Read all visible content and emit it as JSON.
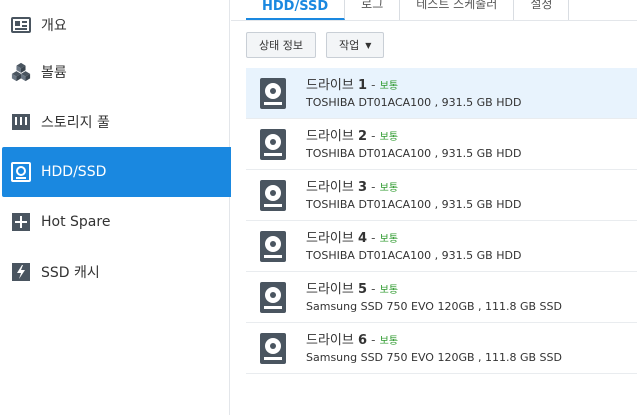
{
  "sidebar": {
    "items": [
      {
        "label": "개요",
        "icon": "overview-icon"
      },
      {
        "label": "볼륨",
        "icon": "volume-icon"
      },
      {
        "label": "스토리지 풀",
        "icon": "storage-pool-icon"
      },
      {
        "label": "HDD/SSD",
        "icon": "hdd-icon",
        "active": true
      },
      {
        "label": "Hot Spare",
        "icon": "hot-spare-icon"
      },
      {
        "label": "SSD 캐시",
        "icon": "ssd-cache-icon"
      }
    ]
  },
  "tabs": [
    {
      "label": "HDD/SSD",
      "active": true
    },
    {
      "label": "로그"
    },
    {
      "label": "테스트 스케줄러"
    },
    {
      "label": "설정"
    }
  ],
  "toolbar": {
    "status_info_label": "상태 정보",
    "action_label": "작업"
  },
  "drives": [
    {
      "name": "드라이브",
      "number": "1",
      "separator": "-",
      "status": "보통",
      "model": "TOSHIBA DT01ACA100 , 931.5 GB HDD",
      "selected": true
    },
    {
      "name": "드라이브",
      "number": "2",
      "separator": "-",
      "status": "보통",
      "model": "TOSHIBA DT01ACA100 , 931.5 GB HDD"
    },
    {
      "name": "드라이브",
      "number": "3",
      "separator": "-",
      "status": "보통",
      "model": "TOSHIBA DT01ACA100 , 931.5 GB HDD"
    },
    {
      "name": "드라이브",
      "number": "4",
      "separator": "-",
      "status": "보통",
      "model": "TOSHIBA DT01ACA100 , 931.5 GB HDD"
    },
    {
      "name": "드라이브",
      "number": "5",
      "separator": "-",
      "status": "보통",
      "model": "Samsung SSD 750 EVO 120GB , 111.8 GB SSD"
    },
    {
      "name": "드라이브",
      "number": "6",
      "separator": "-",
      "status": "보통",
      "model": "Samsung SSD 750 EVO 120GB , 111.8 GB SSD"
    }
  ],
  "colors": {
    "accent": "#1a88e0",
    "status_ok": "#2e9a2e",
    "icon_dark": "#4a5560",
    "selected_row": "#e8f3fd"
  }
}
